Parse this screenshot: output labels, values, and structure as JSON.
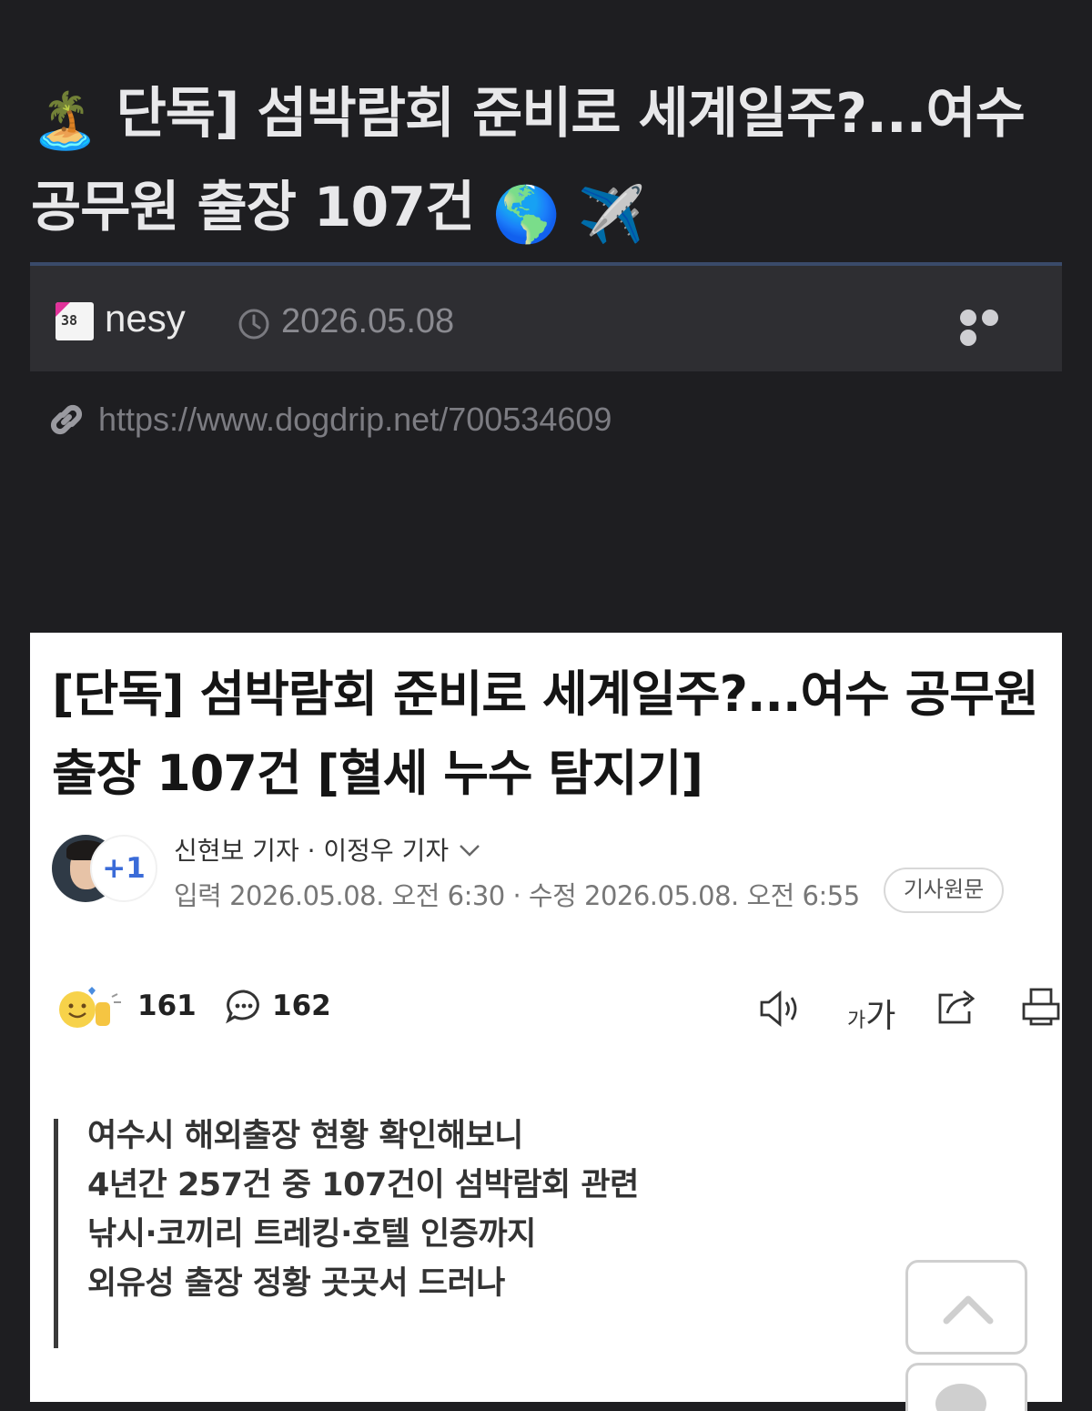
{
  "post": {
    "title_emoji_start": "🏝️",
    "title": "단독] 섬박람회 준비로 세계일주?...여수 공무원 출장 107건",
    "title_emoji_end": "🌎 ✈️",
    "author": "nesy",
    "author_badge": "38",
    "date": "2026.05.08",
    "source_url": "https://www.dogdrip.net/700534609",
    "more_icon": "more-dots-icon"
  },
  "article": {
    "title": "[단독] 섬박람회 준비로 세계일주?...여수 공무원 출장 107건 [혈세 누수 탐지기]",
    "extra_reporters": "+1",
    "reporters": "신현보 기자 · 이정우 기자",
    "dates": "입력 2026.05.08. 오전 6:30 · 수정 2026.05.08. 오전 6:55",
    "original_button": "기사원문",
    "reactions": "161",
    "comments": "162",
    "font_small": "가",
    "font_big": "가",
    "summary": [
      "여수시 해외출장 현황 확인해보니",
      "4년간 257건 중 107건이 섬박람회 관련",
      "낚시·코끼리 트레킹·호텔 인증까지",
      "외유성 출장 정황 곳곳서 드러나"
    ]
  },
  "colors": {
    "background": "#1e1e21",
    "meta_bar": "#2e2e32",
    "accent_blue": "#3a6bd8"
  }
}
